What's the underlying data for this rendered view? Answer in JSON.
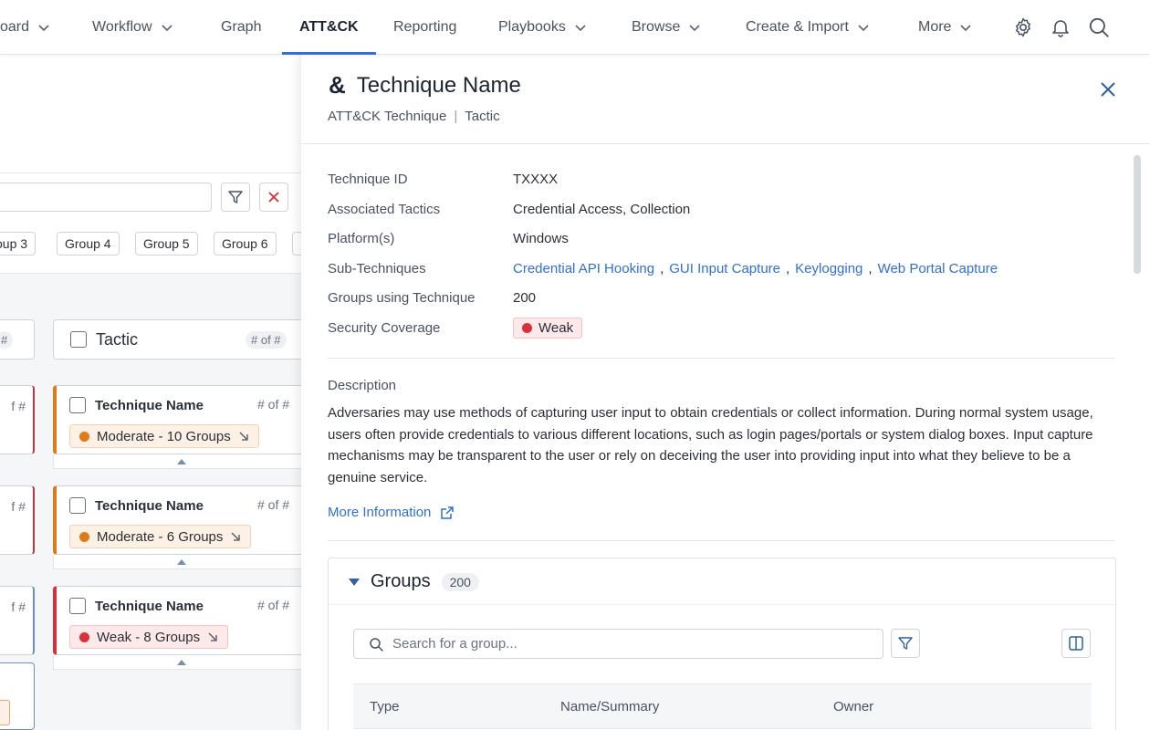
{
  "nav": {
    "items": [
      {
        "label": "oard",
        "dropdown": true
      },
      {
        "label": "Workflow",
        "dropdown": true
      },
      {
        "label": "Graph",
        "dropdown": false
      },
      {
        "label": "ATT&CK",
        "dropdown": false,
        "active": true
      },
      {
        "label": "Reporting",
        "dropdown": false
      },
      {
        "label": "Playbooks",
        "dropdown": true
      },
      {
        "label": "Browse",
        "dropdown": true
      },
      {
        "label": "Create & Import",
        "dropdown": true
      },
      {
        "label": "More",
        "dropdown": true
      }
    ],
    "icons": [
      "gear-icon",
      "bell-icon",
      "search-icon"
    ],
    "accent": "#2f6fe0"
  },
  "matrix": {
    "group_chips": [
      "oup 3",
      "Group 4",
      "Group 5",
      "Group 6"
    ],
    "left_header_count": "#",
    "column_header": {
      "label": "Tactic",
      "count": "# of #"
    },
    "left_card_fragment": "f #",
    "cards": [
      {
        "name": "Technique Name",
        "count": "# of #",
        "level": "Moderate - 10 Groups",
        "status": "moderate"
      },
      {
        "name": "Technique Name",
        "count": "# of #",
        "level": "Moderate - 6 Groups",
        "status": "moderate"
      },
      {
        "name": "Technique Name",
        "count": "# of #",
        "level": "Weak - 8 Groups",
        "status": "weak"
      }
    ],
    "colors": {
      "moderate": "#e07a18",
      "weak": "#d9303e"
    }
  },
  "panel": {
    "title_icon": "&",
    "title": "Technique Name",
    "subtitle_type": "ATT&CK Technique",
    "subtitle_tactic": "Tactic",
    "properties": {
      "technique_id_label": "Technique ID",
      "technique_id": "TXXXX",
      "tactics_label": "Associated Tactics",
      "tactics": "Credential Access, Collection",
      "platforms_label": "Platform(s)",
      "platforms": "Windows",
      "subtech_label": "Sub-Techniques",
      "subtechniques": [
        "Credential API Hooking",
        "GUI Input Capture",
        "Keylogging",
        "Web Portal Capture"
      ],
      "groups_label": "Groups using Technique",
      "groups_count": "200",
      "coverage_label": "Security Coverage",
      "coverage": "Weak"
    },
    "description_label": "Description",
    "description": "Adversaries may use methods of capturing user input to obtain credentials or collect information. During normal system usage, users often provide credentials to various different locations, such as login pages/portals or system dialog boxes. Input capture mechanisms may be transparent to the user or rely on deceiving the user into providing input into what they believe to be a genuine service.",
    "more_info": "More Information",
    "groups": {
      "title": "Groups",
      "count": "200",
      "search_placeholder": "Search for a group...",
      "columns": [
        "Type",
        "Name/Summary",
        "Owner"
      ]
    }
  }
}
